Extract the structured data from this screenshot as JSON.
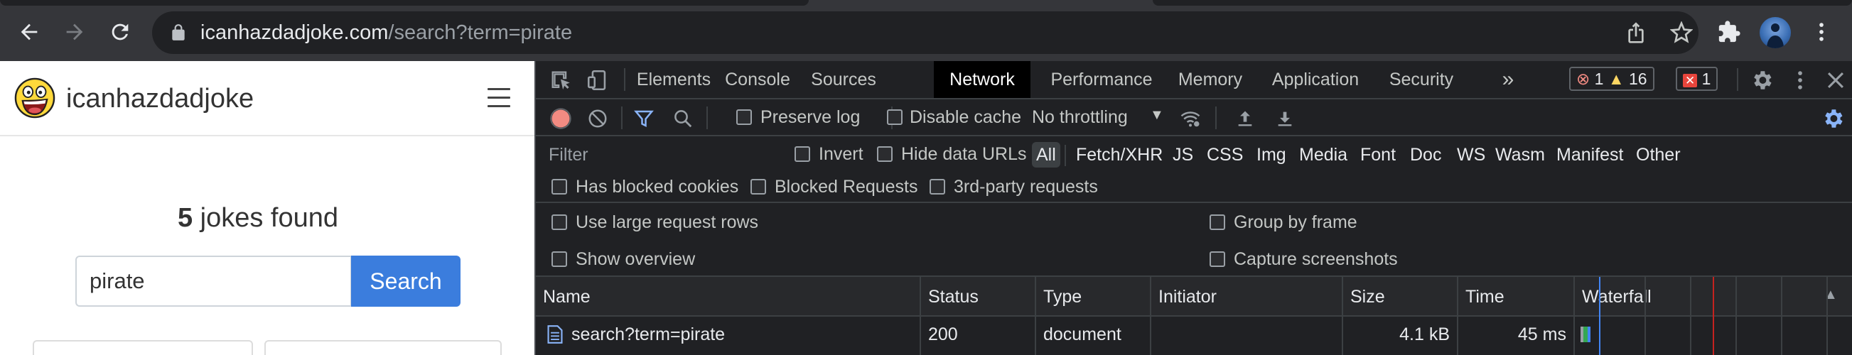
{
  "browser": {
    "url_host": "icanhazdadjoke.com",
    "url_path": "/search?term=pirate",
    "icons": [
      "back-icon",
      "forward-icon",
      "reload-icon",
      "lock-icon",
      "share-icon",
      "star-icon",
      "extensions-icon",
      "avatar",
      "menu-icon"
    ]
  },
  "page": {
    "brand": "icanhazdadjoke",
    "jokes_count": "5",
    "jokes_found_suffix": " jokes found",
    "search_value": "pirate",
    "search_button": "Search"
  },
  "devtools": {
    "tabs": [
      "Elements",
      "Console",
      "Sources",
      "Network",
      "Performance",
      "Memory",
      "Application",
      "Security"
    ],
    "active_tab": "Network",
    "badges": {
      "errors": "1",
      "warnings": "16",
      "issues": "1"
    },
    "network_toolbar": {
      "preserve_log": "Preserve log",
      "disable_cache": "Disable cache",
      "throttling": "No throttling"
    },
    "filter": {
      "placeholder": "Filter",
      "invert": "Invert",
      "hide_data_urls": "Hide data URLs",
      "types": [
        "All",
        "Fetch/XHR",
        "JS",
        "CSS",
        "Img",
        "Media",
        "Font",
        "Doc",
        "WS",
        "Wasm",
        "Manifest",
        "Other"
      ],
      "has_blocked_cookies": "Has blocked cookies",
      "blocked_requests": "Blocked Requests",
      "third_party": "3rd-party requests"
    },
    "settings": {
      "large_rows": "Use large request rows",
      "show_overview": "Show overview",
      "group_by_frame": "Group by frame",
      "capture_screenshots": "Capture screenshots"
    },
    "columns": [
      "Name",
      "Status",
      "Type",
      "Initiator",
      "Size",
      "Time",
      "Waterfall"
    ],
    "requests": [
      {
        "name": "search?term=pirate",
        "status": "200",
        "type": "document",
        "initiator": "",
        "size": "4.1 kB",
        "time": "45 ms"
      }
    ],
    "colors": {
      "accent": "#8ab4f8",
      "record": "#f28b82",
      "active_tab_bg": "#000000"
    }
  }
}
